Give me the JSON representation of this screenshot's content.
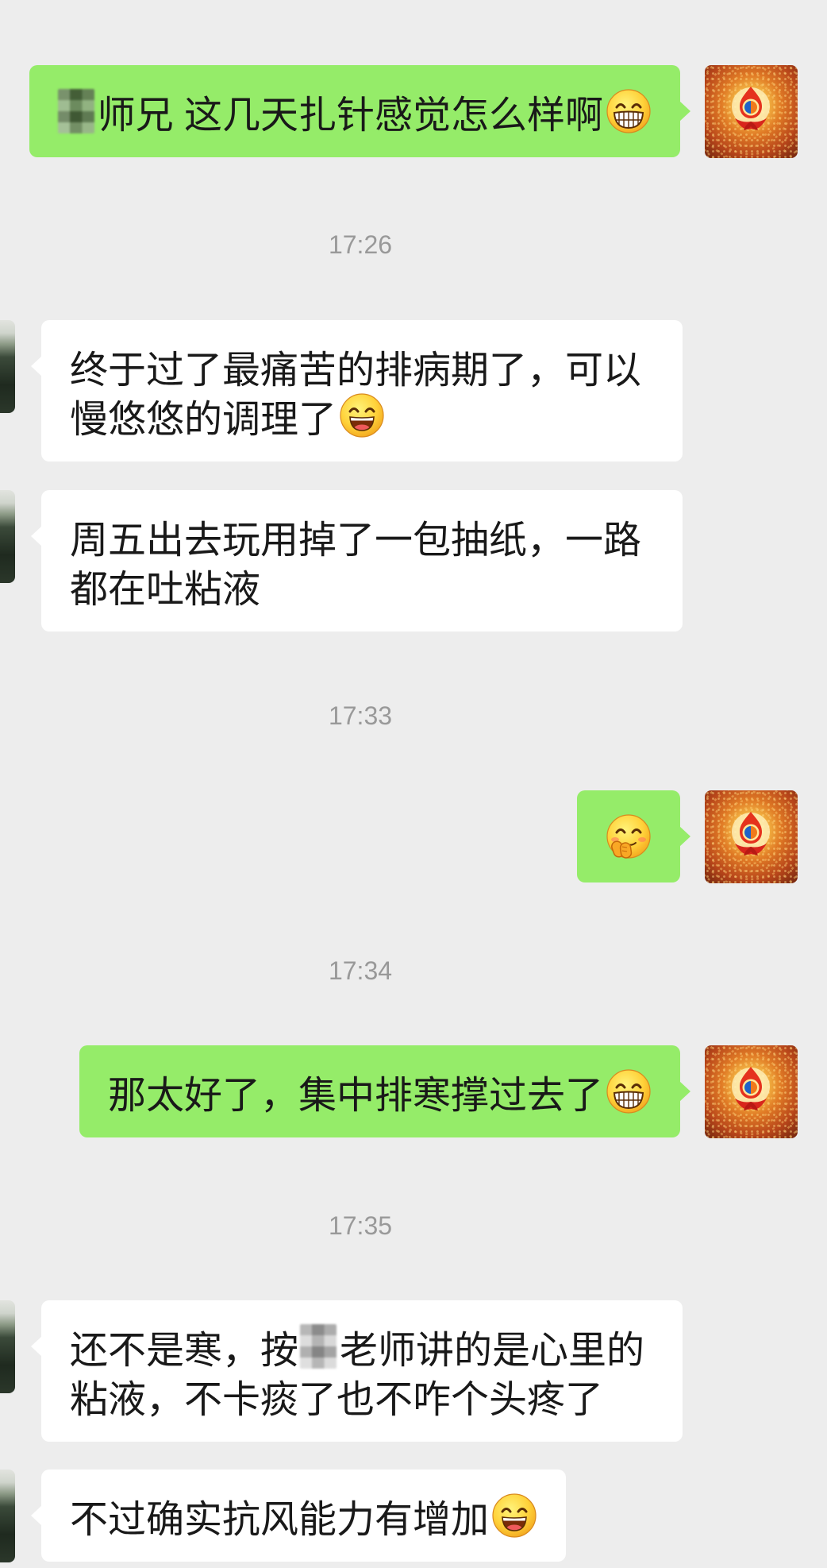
{
  "colors": {
    "background": "#ededed",
    "sent_bubble": "#95ec69",
    "received_bubble": "#ffffff",
    "text": "#191919",
    "timestamp": "#999999"
  },
  "avatars": {
    "me": "lotus-flame-avatar",
    "contact": "contact-photo-avatar"
  },
  "items": [
    {
      "sent": [
        [
          {
            "mosaic": true
          },
          "师兄 这几天扎针感觉怎么样啊",
          {
            "emoji": "grin-emoji"
          }
        ]
      ]
    },
    {
      "time": "17:26"
    },
    {
      "received": [
        [
          "终于过了最痛苦的排病期了，可以"
        ],
        [
          "慢悠悠的调理了",
          {
            "emoji": "laugh-emoji"
          }
        ]
      ]
    },
    {
      "received": [
        [
          "周五出去玩用掉了一包抽纸，一路"
        ],
        [
          "都在吐粘液"
        ]
      ]
    },
    {
      "time": "17:33"
    },
    {
      "sent": [
        [
          {
            "emoji": "cover-mouth-emoji"
          }
        ]
      ]
    },
    {
      "time": "17:34"
    },
    {
      "sent": [
        [
          "那太好了，集中排寒撑过去了",
          {
            "emoji": "grin-emoji"
          }
        ]
      ]
    },
    {
      "time": "17:35"
    },
    {
      "received": [
        [
          "还不是寒，按",
          {
            "mosaic": true
          },
          "老师讲的是心里的"
        ],
        [
          "粘液，不卡痰了也不咋个头疼了"
        ]
      ]
    },
    {
      "received": [
        [
          "不过确实抗风能力有增加",
          {
            "emoji": "laugh-emoji"
          }
        ]
      ]
    }
  ]
}
